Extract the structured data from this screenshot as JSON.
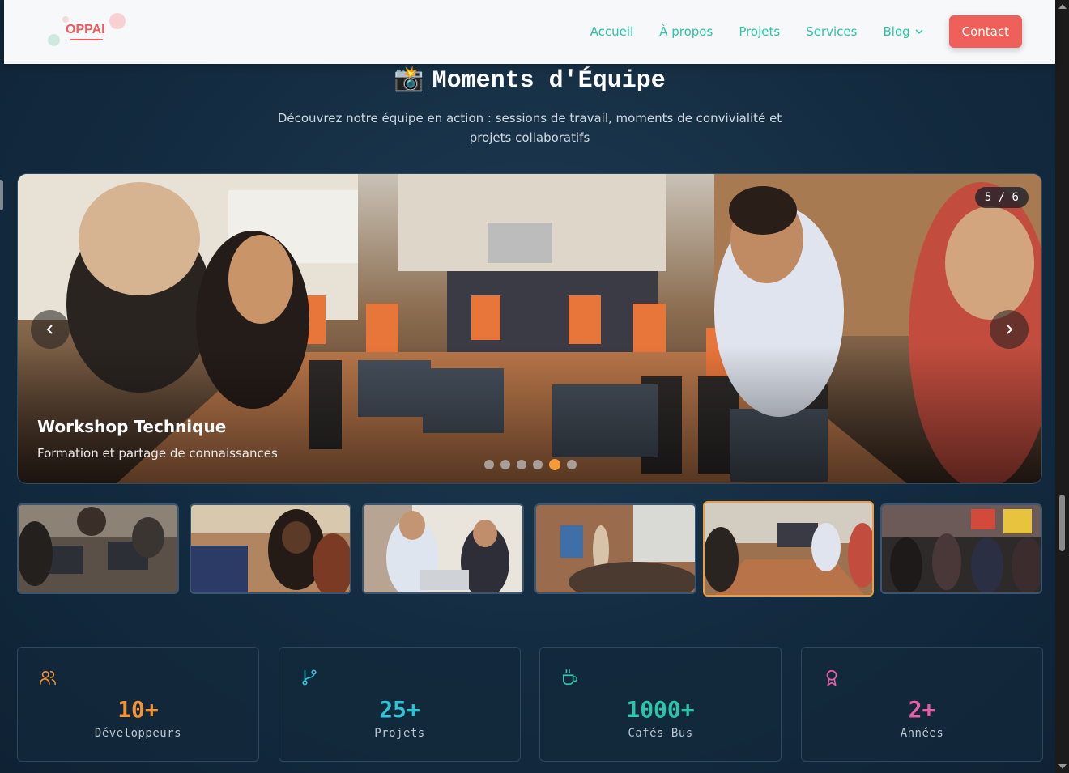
{
  "header": {
    "logo_text": "OPPAI",
    "nav": [
      {
        "label": "Accueil"
      },
      {
        "label": "À propos"
      },
      {
        "label": "Projets"
      },
      {
        "label": "Services"
      },
      {
        "label": "Blog"
      }
    ],
    "contact_label": "Contact"
  },
  "section": {
    "emoji": "📸",
    "title": "Moments d'Équipe",
    "subtitle": "Découvrez notre équipe en action : sessions de travail, moments de convivialité et projets collaboratifs"
  },
  "carousel": {
    "counter": "5 / 6",
    "current_index": 5,
    "total": 6,
    "caption_title": "Workshop Technique",
    "caption_subtitle": "Formation et partage de connaissances",
    "accent_color": "#f39b3b"
  },
  "stats": [
    {
      "value": "10+",
      "label": "Développeurs",
      "color": "#f0943a",
      "icon": "users-icon"
    },
    {
      "value": "25+",
      "label": "Projets",
      "color": "#2ec4d4",
      "icon": "git-branch-icon"
    },
    {
      "value": "1000+",
      "label": "Cafés Bus",
      "color": "#2ec4a9",
      "icon": "coffee-icon"
    },
    {
      "value": "2+",
      "label": "Années",
      "color": "#e85fa6",
      "icon": "award-icon"
    }
  ]
}
